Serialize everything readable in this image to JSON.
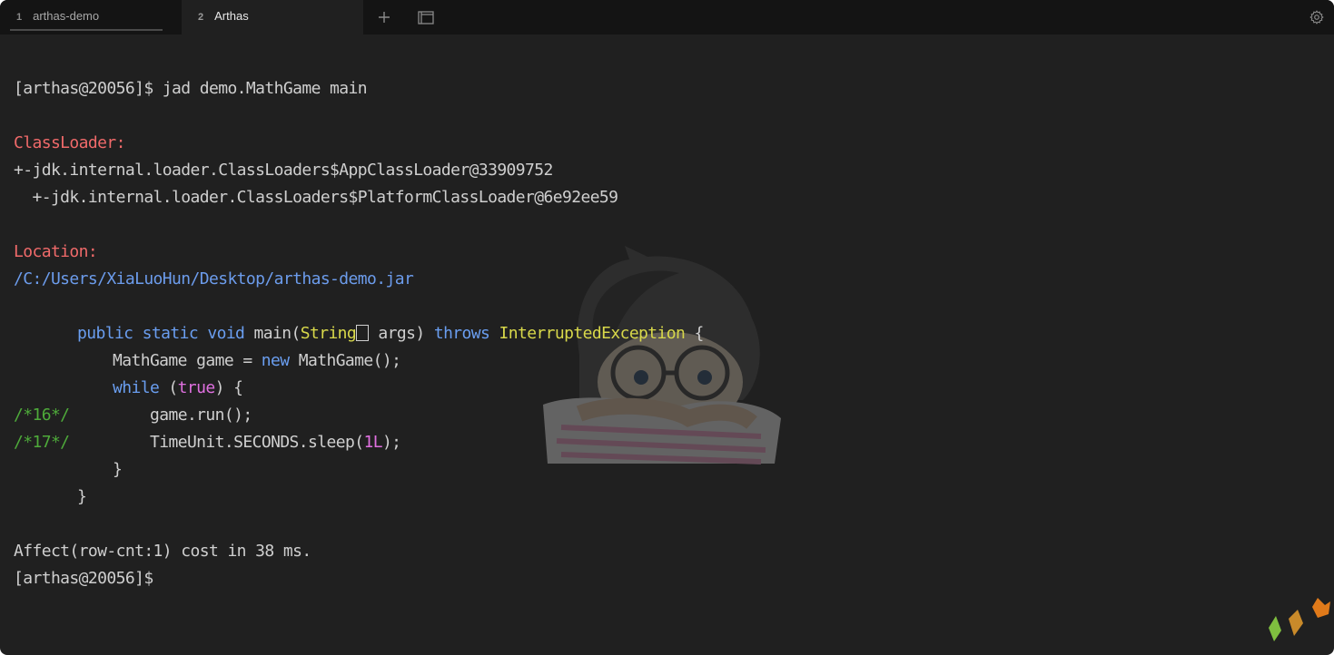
{
  "tabs": [
    {
      "number": "1",
      "label": "arthas-demo"
    },
    {
      "number": "2",
      "label": "Arthas"
    }
  ],
  "icons": {
    "add": "plus-icon",
    "new_window": "window-icon",
    "settings": "gear-icon"
  },
  "terminal": {
    "command_line": "[arthas@20056]$ jad demo.MathGame main",
    "classloader_header": "ClassLoader:",
    "classloader_1": "+-jdk.internal.loader.ClassLoaders$AppClassLoader@33909752",
    "classloader_2": "  +-jdk.internal.loader.ClassLoaders$PlatformClassLoader@6e92ee59",
    "location_header": "Location:",
    "location_path": "/C:/Users/XiaLuoHun/Desktop/arthas-demo.jar",
    "code": {
      "public": "public",
      "static": "static",
      "void": "void",
      "main": "main(",
      "string_type": "String",
      "args": " args) ",
      "throws": "throws",
      "exception": "InterruptedException",
      "brace_open": " {",
      "mathgame_decl": "MathGame game = ",
      "new_kw": "new",
      "mathgame_ctor": " MathGame();",
      "while_kw": "while",
      "paren_open": " (",
      "true_kw": "true",
      "paren_close": ") {",
      "line16_marker": "/*16*/",
      "game_run": "game.run();",
      "line17_marker": "/*17*/",
      "sleep_call": "TimeUnit.SECONDS.sleep(",
      "sleep_arg": "1L",
      "sleep_end": ");",
      "inner_close": "}",
      "outer_close": "}"
    },
    "affect_line": "Affect(row-cnt:1) cost in 38 ms.",
    "prompt": "[arthas@20056]$"
  },
  "colors": {
    "background": "#202020",
    "tabbar": "#141414",
    "error_header": "#f06a6a",
    "keyword": "#6a9ef0",
    "type": "#d8d84a",
    "literal": "#e070e0",
    "line_marker": "#4eaa3a"
  }
}
